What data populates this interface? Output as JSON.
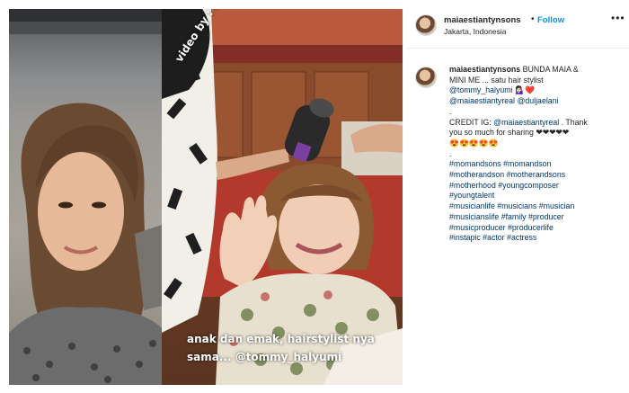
{
  "colors": {
    "link": "#00376b",
    "follow": "#0095f6",
    "text": "#262626"
  },
  "media": {
    "video_credit": "video by : @adelettalina",
    "overlay_line1": "anak dan emak, hairstylist nya",
    "overlay_line2": "sama... @tommy_halyumi"
  },
  "header": {
    "username": "maiaestiantynsons",
    "dot": "•",
    "follow_label": "Follow",
    "location": "Jakarta, Indonesia",
    "more_icon": "more-icon"
  },
  "caption": {
    "username": "maiaestiantynsons",
    "line1": "BUNDA MAIA &",
    "line2": "MINI ME ... satu hair stylist",
    "mention1": "@tommy_halyumi",
    "emoji1": "💁🏻‍♀️❤️",
    "mention2": "@maiaestiantyreal",
    "mention3": "@duljaelani",
    "dot1": ".",
    "credit_prefix": "CREDIT IG:",
    "credit_mention": "@maiaestiantyreal",
    "credit_suffix": ". Thank",
    "line_thanks": "you so much for sharing ❤❤❤❤❤",
    "emoji_row": "😍😍😍😍😍",
    "dot2": ".",
    "hashtag_lines": [
      "#momandsons #momandson",
      "#motherandson #motherandsons",
      "#motherhood #youngcomposer",
      "#youngtalent",
      "#musicianlife #musicians #musician",
      "#musicianslife #family #producer",
      "#musicproducer #producerlife",
      "#instapic #actor #actress"
    ]
  }
}
